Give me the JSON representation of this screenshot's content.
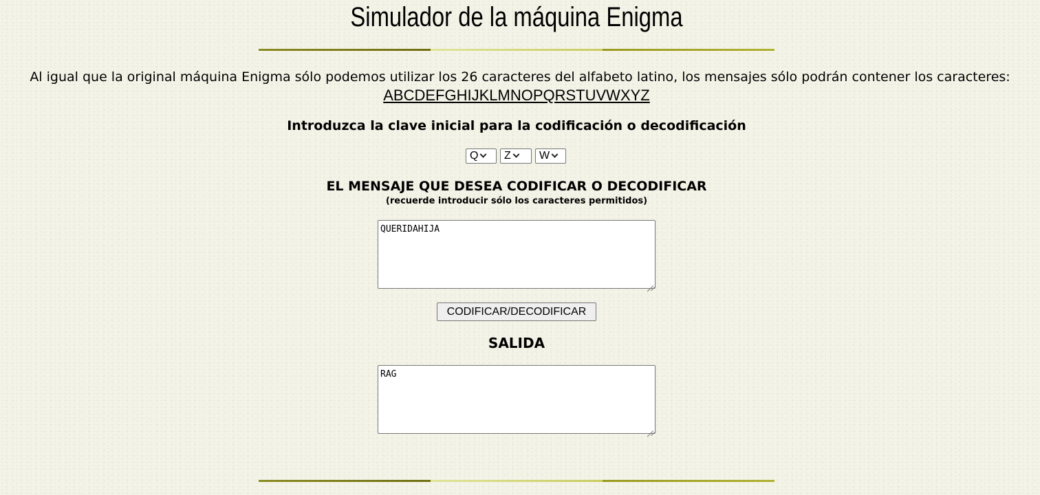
{
  "page": {
    "title": "Simulador de la máquina Enigma"
  },
  "intro": {
    "text": "Al igual que la original máquina Enigma sólo podemos utilizar los 26 caracteres del alfabeto latino, los mensajes sólo podrán contener los caracteres:",
    "alphabet": "ABCDEFGHIJKLMNOPQRSTUVWXYZ"
  },
  "key": {
    "heading": "Introduzca la clave inicial para la codificación o decodificación",
    "rotor1": "Q",
    "rotor2": "Z",
    "rotor3": "W"
  },
  "message": {
    "heading": "EL MENSAJE QUE DESEA CODIFICAR O DECODIFICAR",
    "hint": "(recuerde introducir sólo los caracteres permitidos)",
    "value": "QUERIDAHIJA"
  },
  "action": {
    "button_label": "CODIFICAR/DECODIFICAR"
  },
  "output": {
    "heading": "SALIDA",
    "value": "RAG"
  },
  "colors": {
    "background": "#f4f3e8",
    "rule_dark": "#7a7a14",
    "rule_light": "#d8dc80"
  }
}
